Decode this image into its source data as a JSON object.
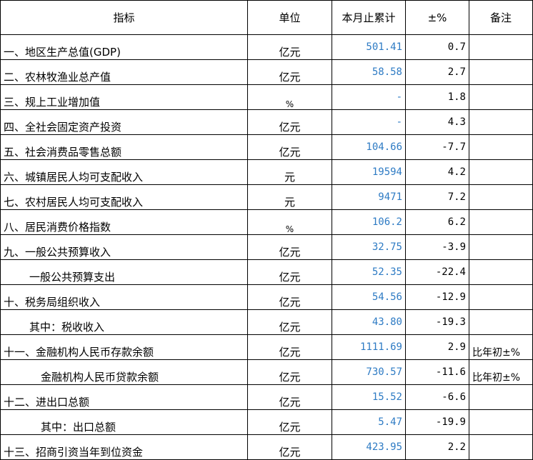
{
  "headers": [
    "指标",
    "单位",
    "本月止累计",
    "±%",
    "备注"
  ],
  "rows": [
    {
      "name": "一、地区生产总值(GDP)",
      "unit": "亿元",
      "value": "501.41",
      "change": "0.7",
      "note": ""
    },
    {
      "name": "二、农林牧渔业总产值",
      "unit": "亿元",
      "value": "58.58",
      "change": "2.7",
      "note": ""
    },
    {
      "name": "三、规上工业增加值",
      "unit": "%",
      "value": "-",
      "change": "1.8",
      "note": ""
    },
    {
      "name": "四、全社会固定资产投资",
      "unit": "亿元",
      "value": "-",
      "change": "4.3",
      "note": ""
    },
    {
      "name": "五、社会消费品零售总额",
      "unit": "亿元",
      "value": "104.66",
      "change": "-7.7",
      "note": ""
    },
    {
      "name": "六、城镇居民人均可支配收入",
      "unit": "元",
      "value": "19594",
      "change": "4.2",
      "note": ""
    },
    {
      "name": "七、农村居民人均可支配收入",
      "unit": "元",
      "value": "9471",
      "change": "7.2",
      "note": ""
    },
    {
      "name": "八、居民消费价格指数",
      "unit": "%",
      "value": "106.2",
      "change": "6.2",
      "note": ""
    },
    {
      "name": "九、一般公共预算收入",
      "unit": "亿元",
      "value": "32.75",
      "change": "-3.9",
      "note": ""
    },
    {
      "name": "一般公共预算支出",
      "unit": "亿元",
      "value": "52.35",
      "change": "-22.4",
      "note": ""
    },
    {
      "name": "十、税务局组织收入",
      "unit": "亿元",
      "value": "54.56",
      "change": "-12.9",
      "note": ""
    },
    {
      "name": "其中：税收收入",
      "unit": "亿元",
      "value": "43.80",
      "change": "-19.3",
      "note": ""
    },
    {
      "name": "十一、金融机构人民币存款余额",
      "unit": "亿元",
      "value": "1111.69",
      "change": "2.9",
      "note": "比年初±%"
    },
    {
      "name": "金融机构人民币贷款余额",
      "unit": "亿元",
      "value": "730.57",
      "change": "-11.6",
      "note": "比年初±%"
    },
    {
      "name": "十二、进出口总额",
      "unit": "亿元",
      "value": "15.52",
      "change": "-6.6",
      "note": ""
    },
    {
      "name": "其中：出口总额",
      "unit": "亿元",
      "value": "5.47",
      "change": "-19.9",
      "note": ""
    },
    {
      "name": "十三、招商引资当年到位资金",
      "unit": "亿元",
      "value": "423.95",
      "change": "2.2",
      "note": ""
    }
  ]
}
